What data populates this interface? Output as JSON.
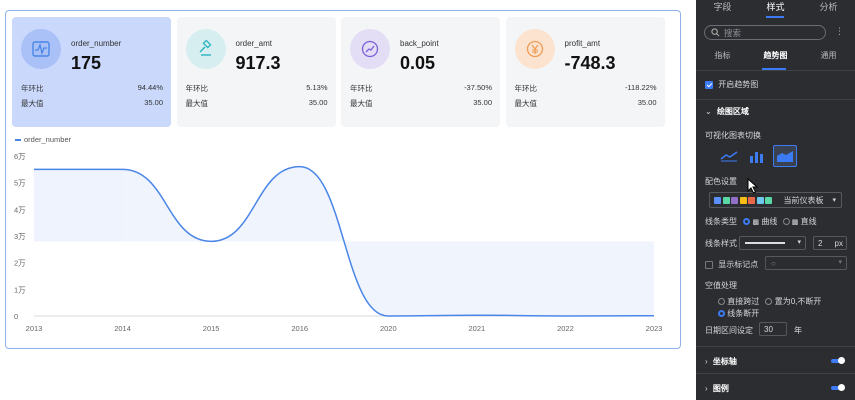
{
  "kpis": [
    {
      "name": "order_number",
      "value": "175",
      "r1_label": "年环比",
      "r1_value": "94.44%",
      "r2_label": "最大值",
      "r2_value": "35.00",
      "icon": "pulse-chart-icon",
      "color": "#4a86e8"
    },
    {
      "name": "order_amt",
      "value": "917.3",
      "r1_label": "年环比",
      "r1_value": "5.13%",
      "r2_label": "最大值",
      "r2_value": "35.00",
      "icon": "gavel-icon",
      "color": "#2bb3c0"
    },
    {
      "name": "back_point",
      "value": "0.05",
      "r1_label": "年环比",
      "r1_value": "-37.50%",
      "r2_label": "最大值",
      "r2_value": "35.00",
      "icon": "trend-arrow-icon",
      "color": "#7b61d9"
    },
    {
      "name": "profit_amt",
      "value": "-748.3",
      "r1_label": "年环比",
      "r1_value": "-118.22%",
      "r2_label": "最大值",
      "r2_value": "35.00",
      "icon": "yuan-coin-icon",
      "color": "#ef9b55"
    }
  ],
  "chart_data": {
    "type": "line",
    "series": [
      {
        "name": "order_number",
        "values": [
          55000,
          55000,
          28000,
          56000,
          0,
          300,
          0,
          100
        ]
      }
    ],
    "categories": [
      "2013",
      "2014",
      "2015",
      "2016",
      "2020",
      "2021",
      "2022",
      "2023"
    ],
    "y_ticks": [
      "0",
      "1万",
      "2万",
      "3万",
      "4万",
      "5万",
      "6万"
    ],
    "ylim": [
      0,
      60000
    ],
    "line_color": "#4a86e8",
    "fill_color": "#eef3fd"
  },
  "panel": {
    "tabs": [
      "字段",
      "样式",
      "分析"
    ],
    "search_placeholder": "搜索",
    "kebab": "⋮",
    "subtabs": [
      "指标",
      "趋势图",
      "通用"
    ],
    "enable_trend": "开启趋势图",
    "section_plot": "绘图区域",
    "chart_switch_label": "可视化图表切换",
    "color_label": "配色设置",
    "color_theme": "当前仪表板",
    "swatches": [
      "#5b8ff9",
      "#5ad8a6",
      "#9270ca",
      "#f6bd16",
      "#e8684a",
      "#6dc8ec",
      "#5ad8a6"
    ],
    "line_type_label": "线条类型",
    "line_type_curve": "曲线",
    "line_type_straight": "直线",
    "line_style_label": "线条样式",
    "line_width": "2",
    "line_width_unit": "px",
    "show_marker": "显示标记点",
    "marker_shape": "○",
    "null_label": "空值处理",
    "null_skip": "直接跨过",
    "null_zero": "置为0,不断开",
    "null_break": "线条断开",
    "date_interval_label": "日期区间设定",
    "date_interval_value": "30",
    "date_interval_unit": "年",
    "section_axis": "坐标轴",
    "section_legend": "图例"
  }
}
